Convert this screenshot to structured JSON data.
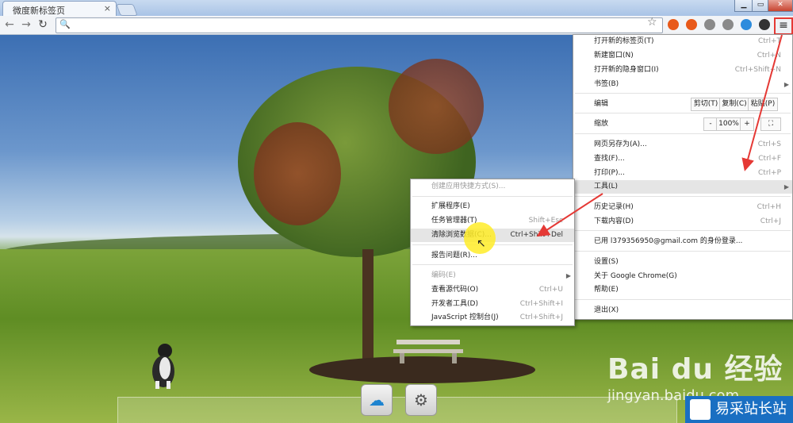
{
  "window": {
    "tab_title": "微度新标签页",
    "tab_close": "×"
  },
  "toolbar": {
    "back_icon": "back-arrow-icon",
    "forward_icon": "forward-arrow-icon",
    "reload_icon": "reload-icon",
    "search_icon_glyph": "🔍",
    "star_glyph": "☆",
    "menu_glyph": "≡",
    "extensions": [
      "#e8591a",
      "#e8591a",
      "#8a8a8a",
      "#8a8a8a",
      "#2d8cdd",
      "#333333"
    ]
  },
  "main_menu": {
    "items": [
      {
        "label": "打开新的标签页(T)",
        "shortcut": "Ctrl+T"
      },
      {
        "label": "新建窗口(N)",
        "shortcut": "Ctrl+N"
      },
      {
        "label": "打开新的隐身窗口(I)",
        "shortcut": "Ctrl+Shift+N"
      },
      {
        "label": "书签(B)",
        "submenu": true
      },
      {
        "label": "编辑",
        "buttons": [
          "剪切(T)",
          "复制(C)",
          "粘贴(P)"
        ]
      },
      {
        "label": "缩放",
        "zoom_minus": "-",
        "zoom_value": "100%",
        "zoom_plus": "+",
        "fullscreen": "⛶"
      },
      {
        "label": "网页另存为(A)...",
        "shortcut": "Ctrl+S"
      },
      {
        "label": "查找(F)...",
        "shortcut": "Ctrl+F"
      },
      {
        "label": "打印(P)...",
        "shortcut": "Ctrl+P"
      },
      {
        "label": "工具(L)",
        "submenu": true
      },
      {
        "label": "历史记录(H)",
        "shortcut": "Ctrl+H"
      },
      {
        "label": "下载内容(D)",
        "shortcut": "Ctrl+J"
      },
      {
        "label": "已用 l379356950@gmail.com 的身份登录..."
      },
      {
        "label": "设置(S)"
      },
      {
        "label": "关于 Google Chrome(G)"
      },
      {
        "label": "帮助(E)"
      },
      {
        "label": "退出(X)"
      }
    ]
  },
  "tools_menu": {
    "items": [
      {
        "label": "创建应用快捷方式(S)..."
      },
      {
        "label": "扩展程序(E)"
      },
      {
        "label": "任务管理器(T)",
        "shortcut": "Shift+Esc"
      },
      {
        "label": "清除浏览数据(C)...",
        "shortcut": "Ctrl+Shift+Del"
      },
      {
        "label": "报告问题(R)..."
      },
      {
        "label": "编码(E)"
      },
      {
        "label": "查看源代码(O)",
        "shortcut": "Ctrl+U"
      },
      {
        "label": "开发者工具(D)",
        "shortcut": "Ctrl+Shift+I"
      },
      {
        "label": "JavaScript 控制台(J)",
        "shortcut": "Ctrl+Shift+J"
      }
    ]
  },
  "dock": {
    "cloud_glyph": "☁",
    "settings_glyph": "⚙"
  },
  "watermark": {
    "main": "Bai du 经验",
    "sub": "jingyan.baidu.com"
  },
  "badge": {
    "text": "易采站长站"
  },
  "colors": {
    "annotation_red": "#e53935",
    "highlight_yellow": "#ffec28"
  }
}
